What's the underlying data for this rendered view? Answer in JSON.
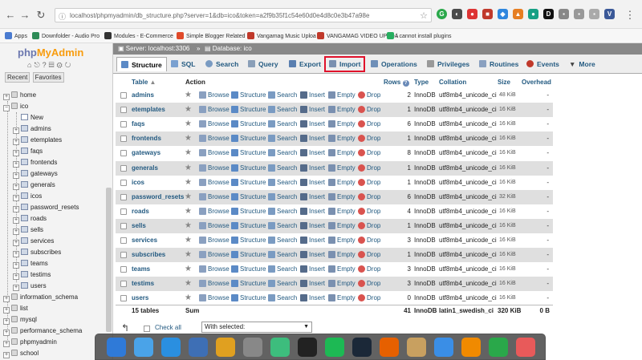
{
  "browser": {
    "url": "localhost/phpmyadmin/db_structure.php?server=1&db=ico&token=a2f9b35f1c54e60d0e4d8c0e3b47a98e",
    "bookmarks": [
      {
        "label": "Apps",
        "color": "#4a7bd0"
      },
      {
        "label": "Downfolder - Audio Pro",
        "color": "#2e8b57"
      },
      {
        "label": "Modules - E-Commerce",
        "color": "#333333"
      },
      {
        "label": "Simple Blogger Related",
        "color": "#e04a2a"
      },
      {
        "label": "Vangamag Music Uploa",
        "color": "#c0392b"
      },
      {
        "label": "VANGAMAG VIDEO UPLOA",
        "color": "#c0392b"
      },
      {
        "label": "i cannot install plugins",
        "color": "#27ae60"
      }
    ]
  },
  "sidebar": {
    "logo_php": "php",
    "logo_my": "MyAdmin",
    "tabs": [
      "Recent",
      "Favorites"
    ],
    "databases": [
      {
        "name": "home",
        "expanded": false
      },
      {
        "name": "ico",
        "expanded": true
      },
      {
        "name": "information_schema",
        "expanded": false
      },
      {
        "name": "list",
        "expanded": false
      },
      {
        "name": "mysql",
        "expanded": false
      },
      {
        "name": "performance_schema",
        "expanded": false
      },
      {
        "name": "phpmyadmin",
        "expanded": false
      },
      {
        "name": "school",
        "expanded": false
      }
    ],
    "new_label": "New",
    "tables": [
      "admins",
      "etemplates",
      "faqs",
      "frontends",
      "gateways",
      "generals",
      "icos",
      "password_resets",
      "roads",
      "sells",
      "services",
      "subscribes",
      "teams",
      "testims",
      "users"
    ]
  },
  "breadcrumb": {
    "server": "Server: localhost:3306",
    "sep": "»",
    "database": "Database: ico"
  },
  "tabs": [
    {
      "label": "Structure",
      "color": "#5b8ac6"
    },
    {
      "label": "SQL",
      "color": "#7aa0d0"
    },
    {
      "label": "Search",
      "color": "#7a9bc2"
    },
    {
      "label": "Query",
      "color": "#8a9fb8"
    },
    {
      "label": "Export",
      "color": "#5a7fb0"
    },
    {
      "label": "Import",
      "color": "#7a90b0"
    },
    {
      "label": "Operations",
      "color": "#6f8fb8"
    },
    {
      "label": "Privileges",
      "color": "#999999"
    },
    {
      "label": "Routines",
      "color": "#8aa0c0"
    },
    {
      "label": "Events",
      "color": "#c0392b"
    },
    {
      "label": "More",
      "color": "#444444"
    }
  ],
  "table_headers": {
    "table": "Table",
    "action": "Action",
    "rows": "Rows",
    "type": "Type",
    "collation": "Collation",
    "size": "Size",
    "overhead": "Overhead"
  },
  "actions": [
    "Browse",
    "Structure",
    "Search",
    "Insert",
    "Empty",
    "Drop"
  ],
  "table_rows": [
    {
      "name": "admins",
      "rows": "2",
      "type": "InnoDB",
      "collation": "utf8mb4_unicode_ci",
      "size": "48 KiB",
      "overhead": "-"
    },
    {
      "name": "etemplates",
      "rows": "1",
      "type": "InnoDB",
      "collation": "utf8mb4_unicode_ci",
      "size": "16 KiB",
      "overhead": "-"
    },
    {
      "name": "faqs",
      "rows": "6",
      "type": "InnoDB",
      "collation": "utf8mb4_unicode_ci",
      "size": "16 KiB",
      "overhead": "-"
    },
    {
      "name": "frontends",
      "rows": "1",
      "type": "InnoDB",
      "collation": "utf8mb4_unicode_ci",
      "size": "16 KiB",
      "overhead": "-"
    },
    {
      "name": "gateways",
      "rows": "8",
      "type": "InnoDB",
      "collation": "utf8mb4_unicode_ci",
      "size": "16 KiB",
      "overhead": "-"
    },
    {
      "name": "generals",
      "rows": "1",
      "type": "InnoDB",
      "collation": "utf8mb4_unicode_ci",
      "size": "16 KiB",
      "overhead": "-"
    },
    {
      "name": "icos",
      "rows": "1",
      "type": "InnoDB",
      "collation": "utf8mb4_unicode_ci",
      "size": "16 KiB",
      "overhead": "-"
    },
    {
      "name": "password_resets",
      "rows": "6",
      "type": "InnoDB",
      "collation": "utf8mb4_unicode_ci",
      "size": "32 KiB",
      "overhead": "-"
    },
    {
      "name": "roads",
      "rows": "4",
      "type": "InnoDB",
      "collation": "utf8mb4_unicode_ci",
      "size": "16 KiB",
      "overhead": "-"
    },
    {
      "name": "sells",
      "rows": "1",
      "type": "InnoDB",
      "collation": "utf8mb4_unicode_ci",
      "size": "16 KiB",
      "overhead": "-"
    },
    {
      "name": "services",
      "rows": "3",
      "type": "InnoDB",
      "collation": "utf8mb4_unicode_ci",
      "size": "16 KiB",
      "overhead": "-"
    },
    {
      "name": "subscribes",
      "rows": "1",
      "type": "InnoDB",
      "collation": "utf8mb4_unicode_ci",
      "size": "16 KiB",
      "overhead": "-"
    },
    {
      "name": "teams",
      "rows": "3",
      "type": "InnoDB",
      "collation": "utf8mb4_unicode_ci",
      "size": "16 KiB",
      "overhead": "-"
    },
    {
      "name": "testims",
      "rows": "3",
      "type": "InnoDB",
      "collation": "utf8mb4_unicode_ci",
      "size": "16 KiB",
      "overhead": "-"
    },
    {
      "name": "users",
      "rows": "0",
      "type": "InnoDB",
      "collation": "utf8mb4_unicode_ci",
      "size": "16 KiB",
      "overhead": "-"
    }
  ],
  "summary": {
    "count": "15 tables",
    "sum": "Sum",
    "rows": "41",
    "type": "InnoDB",
    "collation": "latin1_swedish_ci",
    "size": "320 KiB",
    "overhead": "0 B"
  },
  "footer": {
    "check_all": "Check all",
    "with_selected": "With selected:"
  },
  "dock_icons": [
    {
      "name": "xcode-icon",
      "color": "#2f7ad8"
    },
    {
      "name": "finder-icon",
      "color": "#4aa3e8"
    },
    {
      "name": "app-store-icon",
      "color": "#2a8fe0"
    },
    {
      "name": "quicktime-icon",
      "color": "#3e6fb5"
    },
    {
      "name": "chrome-icon",
      "color": "#e0a020"
    },
    {
      "name": "system-preferences-icon",
      "color": "#888888"
    },
    {
      "name": "atom-icon",
      "color": "#3dbd7d"
    },
    {
      "name": "terminal-icon",
      "color": "#222222"
    },
    {
      "name": "spotify-icon",
      "color": "#1db954"
    },
    {
      "name": "steam-icon",
      "color": "#1b2838"
    },
    {
      "name": "firefox-icon",
      "color": "#e66000"
    },
    {
      "name": "preview-icon",
      "color": "#c8a060"
    },
    {
      "name": "wifi-icon",
      "color": "#3a8ee6"
    },
    {
      "name": "vlc-icon",
      "color": "#f08a00"
    },
    {
      "name": "download-icon",
      "color": "#2aa84a"
    },
    {
      "name": "trash-icon",
      "color": "#e85a5a"
    }
  ]
}
